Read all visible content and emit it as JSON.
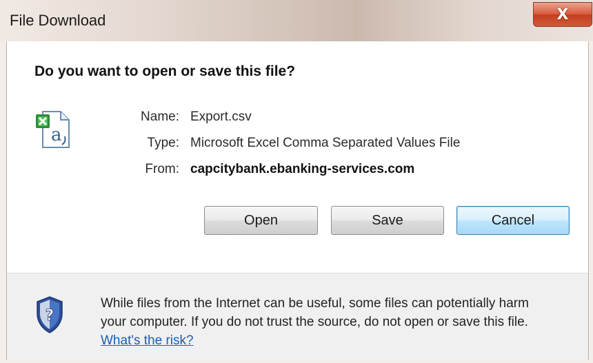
{
  "window": {
    "title": "File Download",
    "close_glyph": "X"
  },
  "dialog": {
    "question": "Do you want to open or save this file?",
    "file_icon": "excel-csv-file-icon",
    "fields": {
      "name_label": "Name:",
      "name_value": "Export.csv",
      "type_label": "Type:",
      "type_value": "Microsoft Excel Comma Separated Values File",
      "from_label": "From:",
      "from_value": "capcitybank.ebanking-services.com"
    },
    "buttons": {
      "open": "Open",
      "save": "Save",
      "cancel": "Cancel"
    }
  },
  "footer": {
    "icon": "security-shield-icon",
    "warning_line1": "While files from the Internet can be useful, some files can potentially harm",
    "warning_line2": "your computer. If you do not trust the source, do not open or save this file.",
    "risk_link": "What's the risk?"
  },
  "colors": {
    "close_button": "#d9583a",
    "default_button": "#bee6fd",
    "link": "#1a5fb4",
    "shield": "#2d4f9a"
  }
}
